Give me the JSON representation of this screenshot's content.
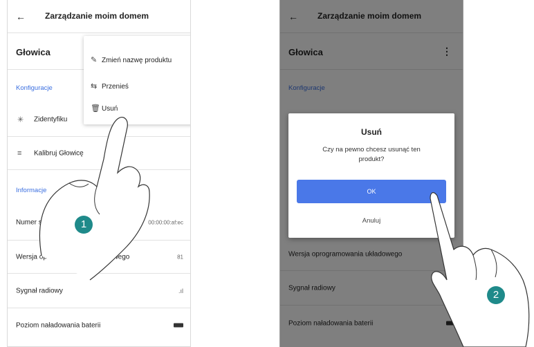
{
  "screen1": {
    "back_icon": "arrow-left-icon",
    "title": "Zarządzanie moim domem",
    "product_title": "Głowica",
    "section_config": "Konfiguracje",
    "identify_label": "Zidentyfiku",
    "calibrate_label": "Kalibruj Głowicę",
    "section_info": "Informacje",
    "serial_label": "Numer seryjny",
    "serial_value": "00:00:00:af:ec",
    "firmware_label": "Wersja oprogramowania układowego",
    "firmware_value": "81",
    "signal_label": "Sygnał radiowy",
    "battery_label": "Poziom naładowania baterii",
    "menu": {
      "rename": "Zmień nazwę produktu",
      "move": "Przenieś",
      "delete": "Usuń"
    },
    "step_badge": "1"
  },
  "screen2": {
    "title": "Zarządzanie moim domem",
    "product_title": "Głowica",
    "section_config": "Konfiguracje",
    "firmware_label": "Wersja oprogramowania układowego",
    "signal_label": "Sygnał radiowy",
    "battery_label": "Poziom naładowania baterii",
    "dialog": {
      "title": "Usuń",
      "message": "Czy na pewno chcesz usunąć ten produkt?",
      "ok": "OK",
      "cancel": "Anuluj"
    },
    "step_badge": "2"
  },
  "colors": {
    "accent": "#3b6fe0",
    "ok_button": "#4a78e8",
    "badge": "#1f8a8a"
  }
}
